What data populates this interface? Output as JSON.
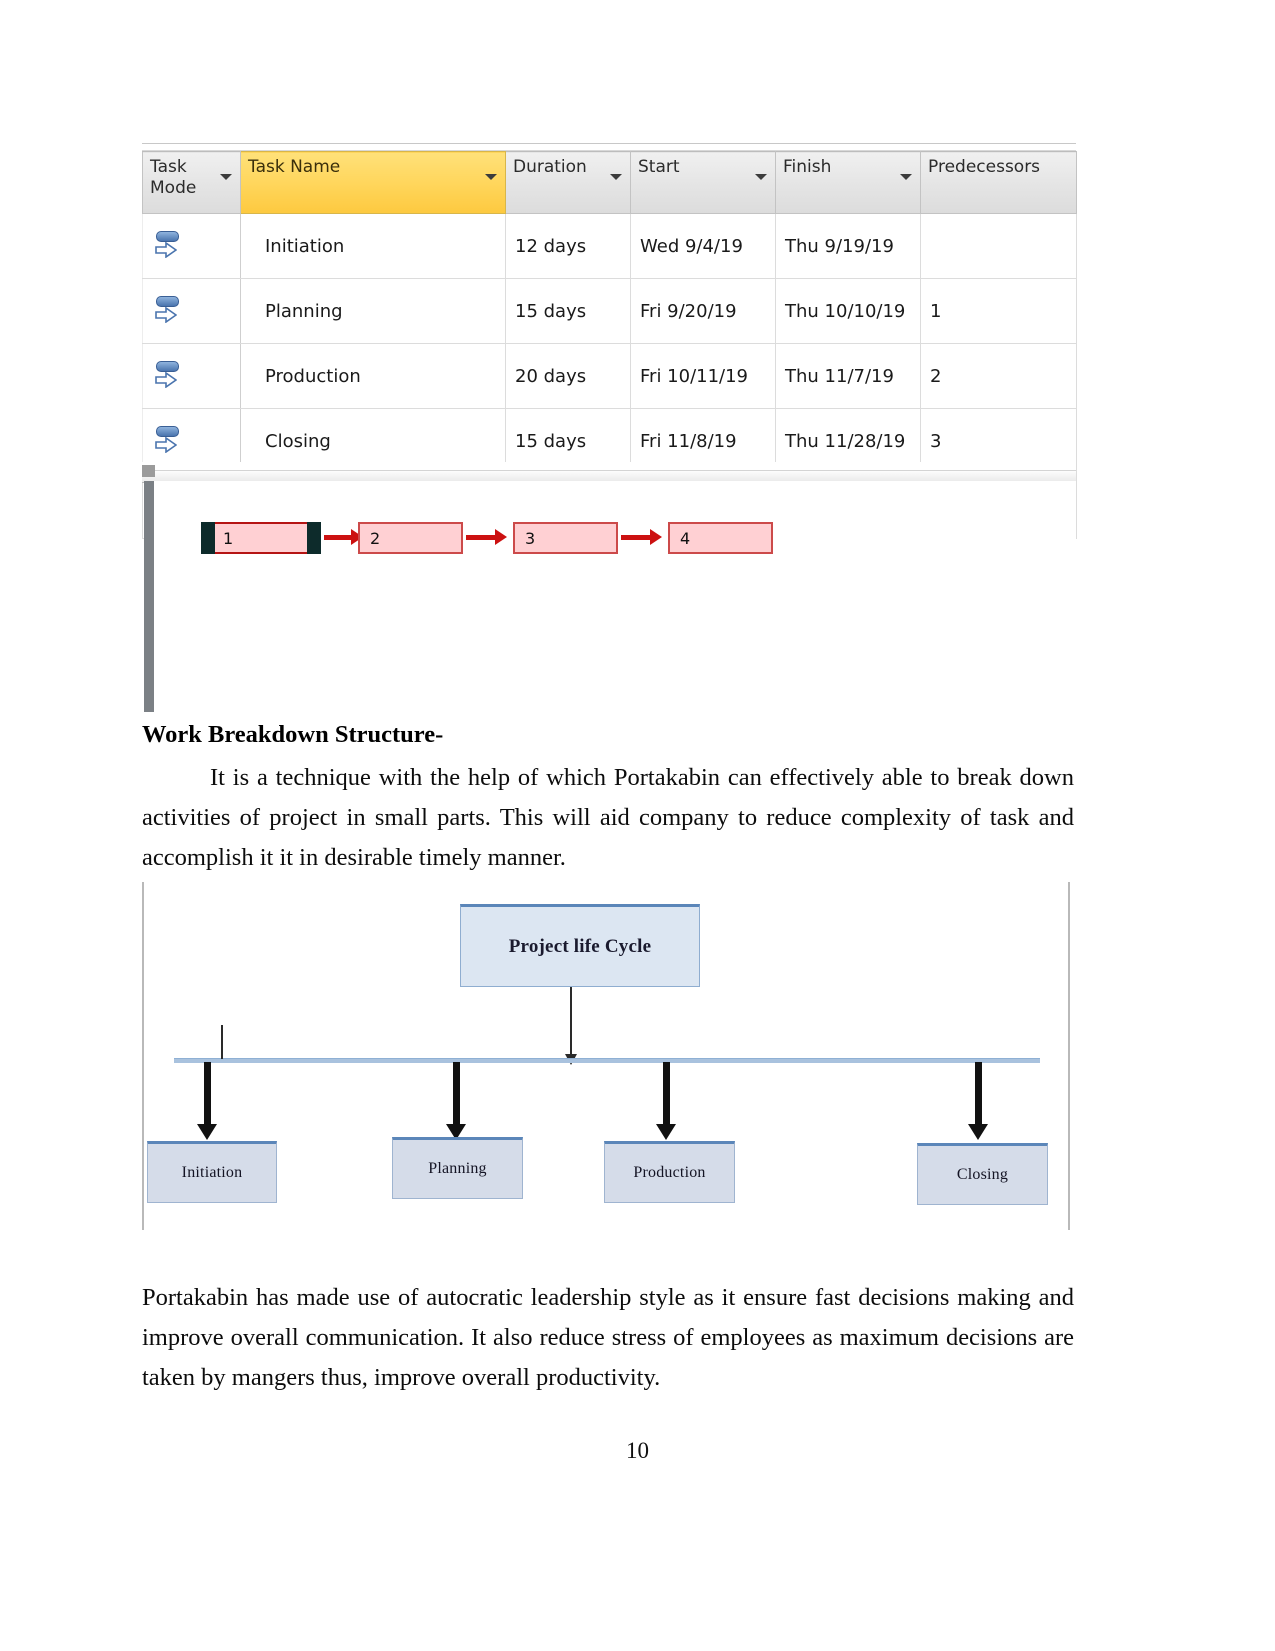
{
  "gantt_table": {
    "columns": [
      {
        "label": "Task Mode",
        "highlighted": false,
        "has_filter": true
      },
      {
        "label": "Task Name",
        "highlighted": true,
        "has_filter": true
      },
      {
        "label": "Duration",
        "highlighted": false,
        "has_filter": true
      },
      {
        "label": "Start",
        "highlighted": false,
        "has_filter": true
      },
      {
        "label": "Finish",
        "highlighted": false,
        "has_filter": true
      },
      {
        "label": "Predecessors",
        "highlighted": false,
        "has_filter": true
      }
    ],
    "rows": [
      {
        "mode_icon": "auto-scheduled-icon",
        "name": "Initiation",
        "duration": "12 days",
        "start": "Wed 9/4/19",
        "finish": "Thu 9/19/19",
        "predecessors": ""
      },
      {
        "mode_icon": "auto-scheduled-icon",
        "name": "Planning",
        "duration": "15 days",
        "start": "Fri 9/20/19",
        "finish": "Thu 10/10/19",
        "predecessors": "1"
      },
      {
        "mode_icon": "auto-scheduled-icon",
        "name": "Production",
        "duration": "20 days",
        "start": "Fri 10/11/19",
        "finish": "Thu 11/7/19",
        "predecessors": "2"
      },
      {
        "mode_icon": "auto-scheduled-icon",
        "name": "Closing",
        "duration": "15 days",
        "start": "Fri 11/8/19",
        "finish": "Thu 11/28/19",
        "predecessors": "3"
      }
    ],
    "header_highlight_color": "#ffd65c",
    "header_bg_color": "#e4e4e4"
  },
  "network_diagram": {
    "nodes": [
      {
        "label": "1",
        "selected": true
      },
      {
        "label": "2",
        "selected": false
      },
      {
        "label": "3",
        "selected": false
      },
      {
        "label": "4",
        "selected": false
      }
    ],
    "node_fill_color": "#ffd0d3",
    "node_border_color": "#cc4a4a",
    "arrow_color": "#cc1111"
  },
  "heading": {
    "text": "Work Breakdown Structure-"
  },
  "paragraphs": {
    "wbs_intro": "It is a technique with the help of which  Portakabin can effectively able to break down activities of project in small parts. This will aid company to reduce complexity of task and accomplish it it in desirable timely manner.",
    "leadership": "Portakabin has made use of autocratic leadership style as it ensure fast decisions making and improve overall communication. It also reduce stress of employees as maximum decisions are taken by mangers thus, improve overall productivity."
  },
  "wbs_diagram": {
    "root": "Project life Cycle",
    "leaves": [
      {
        "label": "Initiation"
      },
      {
        "label": "Planning"
      },
      {
        "label": "Production"
      },
      {
        "label": "Closing"
      }
    ],
    "box_fill_color": "#d5dce9",
    "box_accent_color": "#5b86b9",
    "connector_color": "#a9c2de"
  },
  "footer": {
    "page_number": "10"
  }
}
